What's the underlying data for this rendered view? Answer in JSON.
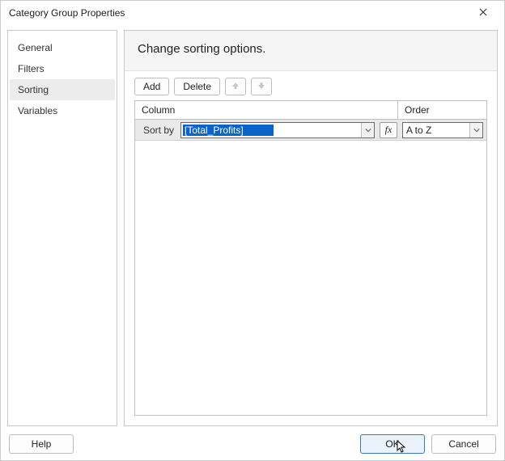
{
  "window": {
    "title": "Category Group Properties"
  },
  "sidebar": {
    "items": [
      {
        "label": "General"
      },
      {
        "label": "Filters"
      },
      {
        "label": "Sorting"
      },
      {
        "label": "Variables"
      }
    ]
  },
  "main": {
    "heading": "Change sorting options.",
    "toolbar": {
      "add": "Add",
      "delete": "Delete"
    },
    "grid": {
      "col_column": "Column",
      "col_order": "Order",
      "rows": [
        {
          "label": "Sort by",
          "column_value": "[Total_Profits]",
          "order_value": "A to Z"
        }
      ]
    },
    "fx_label": "fx"
  },
  "footer": {
    "help": "Help",
    "ok": "OK",
    "cancel": "Cancel"
  }
}
